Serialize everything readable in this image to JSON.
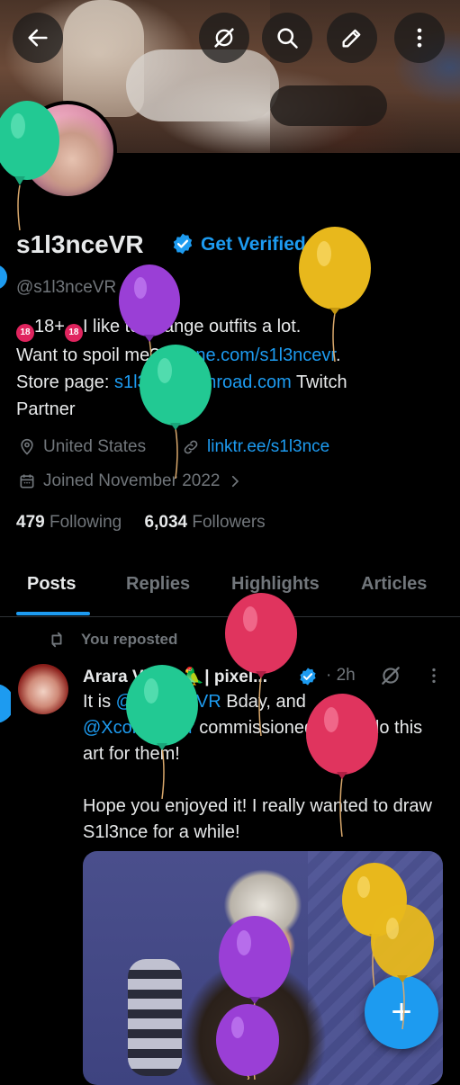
{
  "profile": {
    "name": "s1l3nceVR",
    "get_verified": "Get Verified",
    "handle": "@s1l3nceVR",
    "age_badge": "18",
    "bio_line1_after_badge": "18+",
    "bio_line1_rest": "I like to change outfits a lot.",
    "bio_line2_text": "Want to spoil me? ",
    "bio_line2_link": "throne.com/s1l3ncevr",
    "bio_line2_end": ".",
    "bio_line3_text": "Store page: ",
    "bio_line3_link": "s1l3nce.gumroad.com",
    "bio_line3_end": " Twitch",
    "bio_line4": "Partner",
    "location": "United States",
    "website": "linktr.ee/s1l3nce",
    "joined": "Joined November 2022",
    "following_count": "479",
    "following_label": "Following",
    "followers_count": "6,034",
    "followers_label": "Followers"
  },
  "tabs": [
    "Posts",
    "Replies",
    "Highlights",
    "Articles"
  ],
  "post": {
    "repost_label": "You reposted",
    "author": "Arara Vilano🦜| pixel...",
    "time": "· 2h",
    "t1": "It is ",
    "m1": "@s1l3nceVR",
    "t2": " Bday, and",
    "m2": "@XconSniper",
    "t3": " commissioned me to do this art for them!",
    "t4": "Hope you enjoyed it! I really wanted to draw S1l3nce for a while!"
  },
  "fab_label": "+",
  "icons": [
    "back-arrow-icon",
    "grok-icon",
    "search-icon",
    "edit-icon",
    "more-vertical-icon",
    "verified-badge-icon",
    "location-pin-icon",
    "link-icon",
    "calendar-icon",
    "chevron-right-icon",
    "repost-icon",
    "compose-plus-icon"
  ],
  "colors": {
    "accent": "#1d9bf0",
    "background": "#000000",
    "text": "#e7e9ea",
    "muted": "#71767b",
    "balloon_green": "#22c993",
    "balloon_purple": "#9a3fd6",
    "balloon_yellow": "#e8b81c",
    "balloon_red": "#e0345e"
  }
}
